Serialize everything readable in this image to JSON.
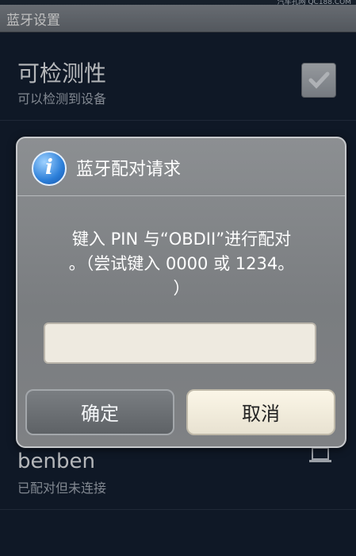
{
  "app_title": "蓝牙设置",
  "watermark": "汽车孔网 QC188.COM",
  "list": {
    "discoverable": {
      "title": "可检测性",
      "subtitle": "可以检测到设备",
      "checked": true
    },
    "devices": [
      {
        "name": "benben",
        "status": "已配对但未连接",
        "icon": "laptop-icon"
      }
    ]
  },
  "dialog": {
    "title": "蓝牙配对请求",
    "icon": "info-icon",
    "message": "键入 PIN 与“OBDII”进行配对\n。（尝试键入 0000 或 1234。\n）",
    "pin_value": "",
    "ok_label": "确定",
    "cancel_label": "取消"
  }
}
